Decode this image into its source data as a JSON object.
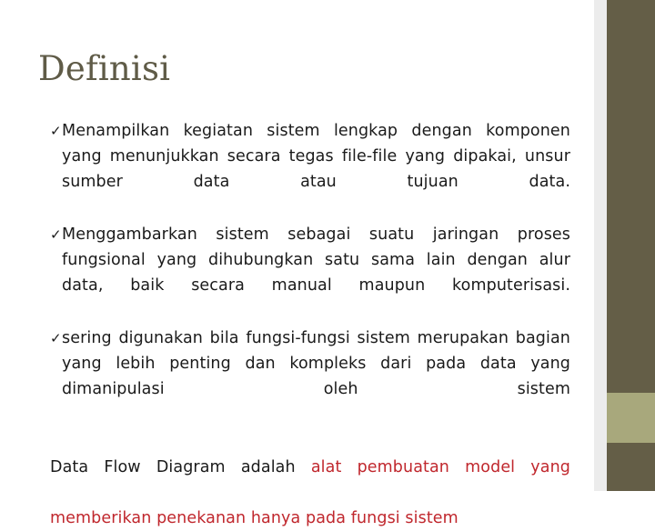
{
  "slide": {
    "title": "Definisi",
    "bullet_marker": "✓",
    "bullets": [
      {
        "text": "Menampilkan kegiatan sistem lengkap dengan komponen yang menunjukkan secara tegas file-file yang dipakai, unsur sumber data atau tujuan data."
      },
      {
        "text": "Menggambarkan sistem sebagai suatu jaringan proses fungsional yang dihubungkan satu sama lain dengan alur data, baik secara manual maupun komputerisasi."
      },
      {
        "text": "sering digunakan bila fungsi-fungsi sistem merupakan bagian yang lebih penting dan kompleks dari pada data yang dimanipulasi oleh sistem"
      }
    ],
    "closing": {
      "lead": "Data Flow Diagram adalah ",
      "accent_line1": "alat pembuatan model yang",
      "accent_line2": "memberikan penekanan hanya pada fungsi sistem"
    }
  },
  "theme": {
    "background": "#ffffff",
    "title_color": "#5F5B47",
    "body_color": "#1A1A1A",
    "accent_color": "#C0272D",
    "rail_dark": "#645E47",
    "rail_light": "#A8A87C",
    "rail_gap": "#ECECEC"
  }
}
